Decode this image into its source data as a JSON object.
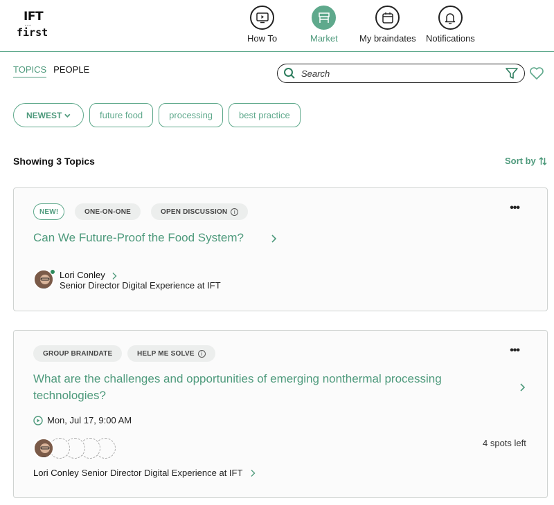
{
  "logo": {
    "text_top": "IFT",
    "text_bottom": "first"
  },
  "nav": [
    {
      "label": "How To",
      "icon": "play-icon",
      "active": false
    },
    {
      "label": "Market",
      "icon": "market-stall-icon",
      "active": true
    },
    {
      "label": "My braindates",
      "icon": "calendar-icon",
      "active": false
    },
    {
      "label": "Notifications",
      "icon": "bell-icon",
      "active": false
    }
  ],
  "tabs": [
    {
      "label": "TOPICS",
      "active": true
    },
    {
      "label": "PEOPLE",
      "active": false
    }
  ],
  "search": {
    "placeholder": "Search"
  },
  "filters": {
    "sort_label": "NEWEST",
    "chips": [
      "future food",
      "processing",
      "best practice"
    ]
  },
  "results": {
    "showing": "Showing 3 Topics",
    "sort_by": "Sort by"
  },
  "topics": [
    {
      "badges": [
        "NEW!",
        "ONE-ON-ONE",
        "OPEN DISCUSSION"
      ],
      "title": "Can We Future-Proof the Food System?",
      "host_name": "Lori Conley",
      "host_role": "Senior Director Digital Experience at IFT"
    },
    {
      "badges": [
        "GROUP BRAINDATE",
        "HELP ME SOLVE"
      ],
      "title": "What are the challenges and opportunities of emerging nonthermal processing technologies?",
      "date": "Mon, Jul 17, 9:00 AM",
      "spots_left": "4 spots left",
      "host_name": "Lori Conley",
      "host_role": "Senior Director Digital Experience at IFT"
    }
  ],
  "colors": {
    "accent": "#5fa98c",
    "accent_text": "#4e9a7c",
    "badge_bg": "#eceeed"
  }
}
